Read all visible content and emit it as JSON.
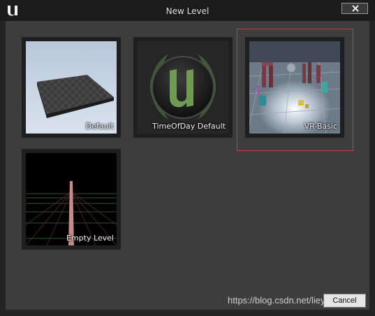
{
  "window": {
    "title": "New Level",
    "accent_color": "#d23c3c"
  },
  "icons": {
    "app": "unreal-engine-logo-icon",
    "close": "close-x-icon"
  },
  "templates": [
    {
      "label": "Default",
      "highlighted": false
    },
    {
      "label": "TimeOfDay Default",
      "highlighted": false
    },
    {
      "label": "VR-Basic",
      "highlighted": true
    },
    {
      "label": "Empty Level",
      "highlighted": false
    }
  ],
  "footer": {
    "cancel_label": "Cancel",
    "watermark": "https://blog.csdn.net/lieyanhf"
  }
}
